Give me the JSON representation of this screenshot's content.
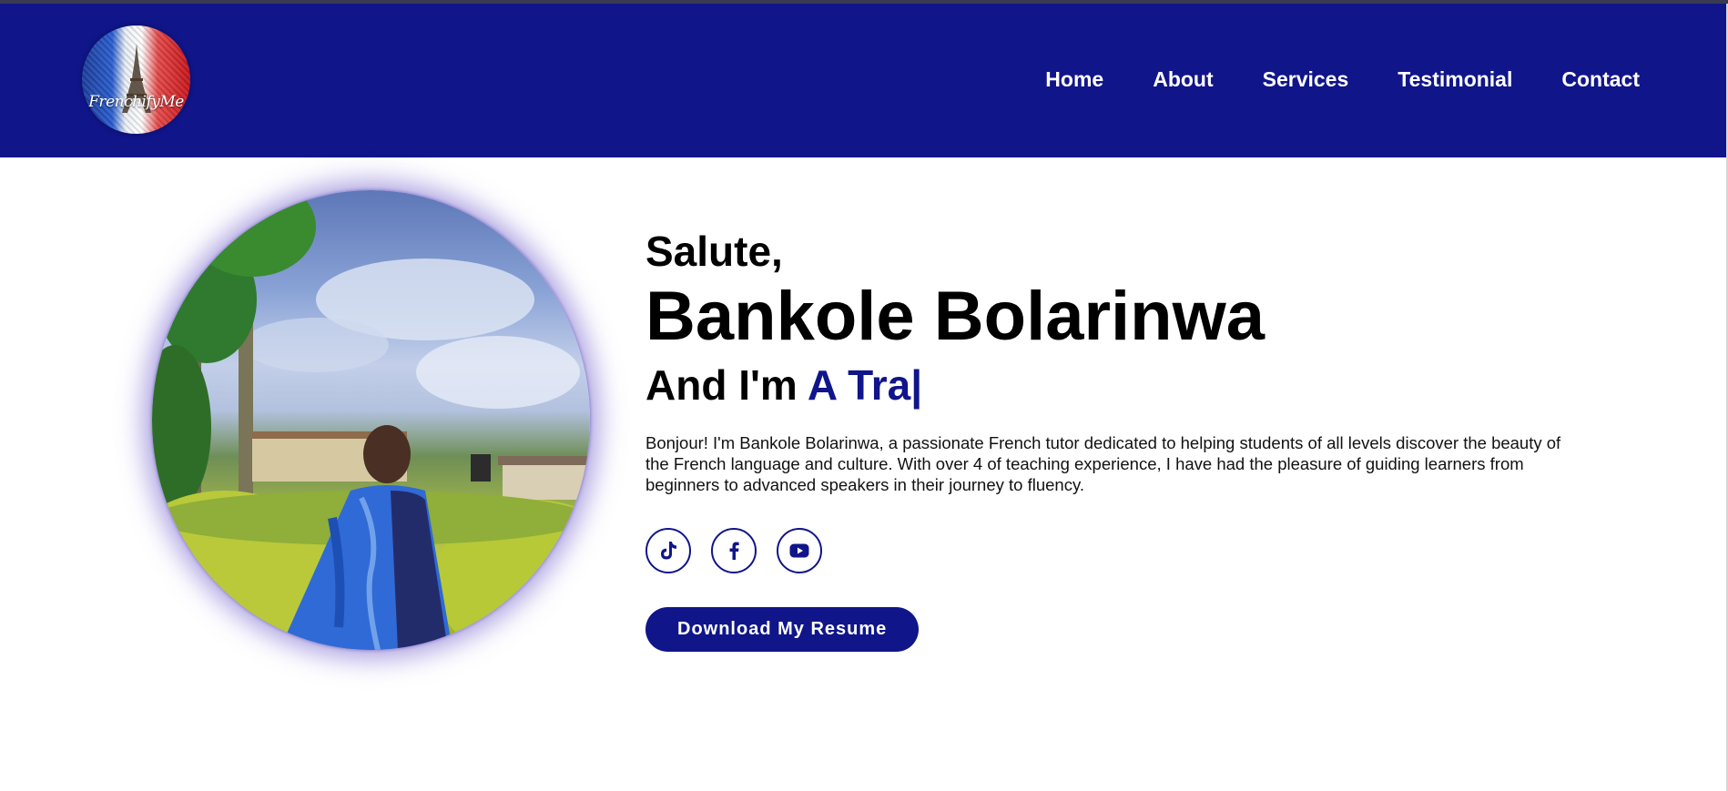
{
  "header": {
    "logo_text": "FrenchifyMe",
    "nav": [
      {
        "label": "Home"
      },
      {
        "label": "About"
      },
      {
        "label": "Services"
      },
      {
        "label": "Testimonial"
      },
      {
        "label": "Contact"
      }
    ]
  },
  "hero": {
    "greeting": "Salute,",
    "name": "Bankole Bolarinwa",
    "role_prefix": "And I'm ",
    "role_typed": "A Tra|",
    "bio": "Bonjour! I'm Bankole Bolarinwa, a passionate French tutor dedicated to helping students of all levels discover the beauty of the French language and culture. With over 4 of teaching experience, I have had the pleasure of guiding learners from beginners to advanced speakers in their journey to fluency.",
    "socials": [
      {
        "icon": "tiktok-icon"
      },
      {
        "icon": "facebook-icon"
      },
      {
        "icon": "youtube-icon"
      }
    ],
    "resume_button": "Download My Resume"
  },
  "colors": {
    "brand": "#10158a",
    "background": "#ffffff",
    "nav_text": "#ffffff"
  }
}
